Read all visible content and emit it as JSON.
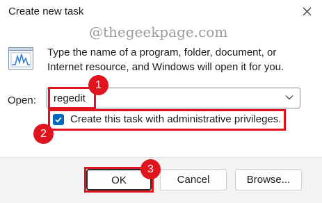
{
  "window": {
    "title": "Create new task"
  },
  "watermark": "@thegeekpage.com",
  "icons": {
    "app": "run-dialog-icon",
    "close": "close-icon",
    "dropdown": "chevron-down-icon",
    "checkbox": "checkmark-icon"
  },
  "description": "Type the name of a program, folder, document, or Internet resource, and Windows will open it for you.",
  "open_field": {
    "label": "Open:",
    "value": "regedit"
  },
  "admin_checkbox": {
    "label": "Create this task with administrative privileges.",
    "checked": true
  },
  "buttons": {
    "ok": "OK",
    "cancel": "Cancel",
    "browse": "Browse..."
  },
  "annotations": {
    "step1": "1",
    "step2": "2",
    "step3": "3"
  },
  "colors": {
    "highlight": "#e0141e",
    "checkbox_accent": "#0067c0",
    "footer_bg": "#f3f3f3"
  }
}
